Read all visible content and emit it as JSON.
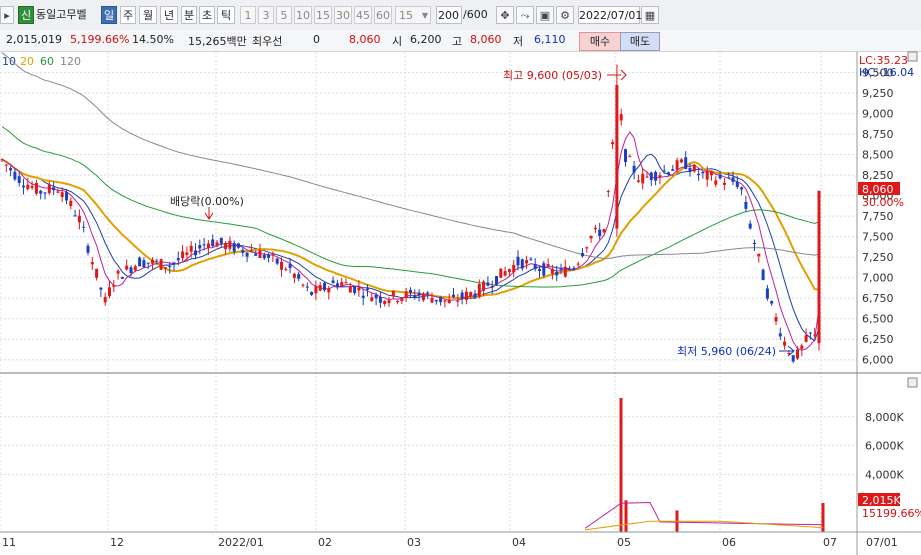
{
  "toolbar": {
    "stock_badge": "신",
    "stock_name": "동일고무벨",
    "period_tabs": [
      "일",
      "주",
      "월",
      "년",
      "분",
      "초",
      "틱"
    ],
    "selected_period": "일",
    "minute_options": [
      "1",
      "3",
      "5",
      "10",
      "15",
      "30",
      "45",
      "60"
    ],
    "minute_select_value": "15",
    "count_value": "200",
    "count_total": "/600",
    "date_value": "2022/07/01"
  },
  "infobar": {
    "volume": "2,015,019",
    "volume_ratio": "5,199.66%",
    "turnover": "14.50%",
    "amount": "15,265백만",
    "quote_label": "최우선",
    "quote_value": "0",
    "current_price": "8,060",
    "open_label": "시",
    "open_value": "6,200",
    "high_label": "고",
    "high_value": "8,060",
    "low_label": "저",
    "low_value": "6,110",
    "buy_label": "매수",
    "sell_label": "매도"
  },
  "legend": {
    "items": [
      {
        "label": "10",
        "color": "#1f3fa8"
      },
      {
        "label": "20",
        "color": "#e0a000"
      },
      {
        "label": "60",
        "color": "#2a9a3a"
      },
      {
        "label": "120",
        "color": "#888888"
      }
    ]
  },
  "colors": {
    "up": "#e01818",
    "down": "#1c3fc0"
  },
  "chart_data": [
    {
      "type": "candlestick",
      "title": "",
      "y_ticks": [
        "6,000",
        "6,250",
        "6,500",
        "6,750",
        "7,000",
        "7,250",
        "7,500",
        "7,750",
        "8,000",
        "8,250",
        "8,500",
        "8,750",
        "9,000",
        "9,250",
        "9,500"
      ],
      "ylim": [
        5850,
        9630
      ],
      "x_ticks": [
        "11",
        "12",
        "2022/01",
        "02",
        "03",
        "04",
        "05",
        "06",
        "07",
        "07/01"
      ],
      "lc_label": "LC:35.23",
      "hc_label": "HC:-16.04",
      "last_price_tag": "8,060",
      "last_change_tag": "30.00%",
      "annotations": {
        "high": "최고 9,600 (05/03)",
        "low": "최저 5,960 (06/24)",
        "dividend": "배당락(0.00%)"
      },
      "ohlc_key_points": [
        {
          "x": "11",
          "close": 8460
        },
        {
          "x": "12",
          "close": 6700
        },
        {
          "x": "2022/01",
          "close": 7200
        },
        {
          "x": "02",
          "close": 7300
        },
        {
          "x": "03",
          "close": 6750
        },
        {
          "x": "04",
          "close": 7000
        },
        {
          "x": "05",
          "close": 9100
        },
        {
          "x": "06",
          "close": 8200
        },
        {
          "x": "06/24",
          "close": 6000
        },
        {
          "x": "07",
          "close": 8060
        }
      ]
    },
    {
      "type": "bar",
      "title": "",
      "y_ticks": [
        "4,000K",
        "6,000K",
        "8,000K"
      ],
      "last_volume_tag": "2,015K",
      "last_ratio_tag": "15199.66%",
      "spikes": [
        {
          "x": "05/03",
          "value": 9300
        },
        {
          "x": "05 (2)",
          "value": 2200
        },
        {
          "x": "05 (3)",
          "value": 1500
        },
        {
          "x": "07",
          "value": 2015
        }
      ]
    }
  ]
}
